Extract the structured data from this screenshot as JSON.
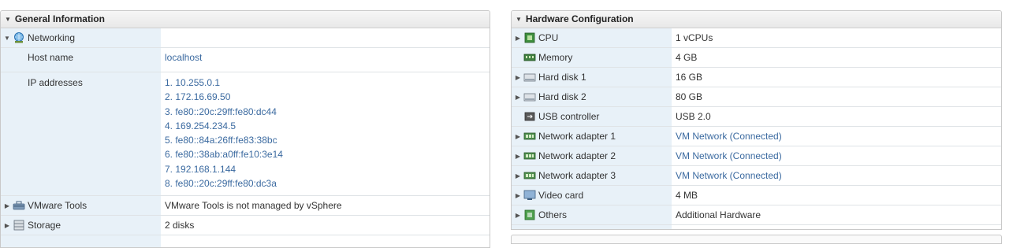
{
  "general": {
    "title": "General Information",
    "networking": {
      "label": "Networking"
    },
    "host_name": {
      "label": "Host name",
      "value": "localhost"
    },
    "ip_addresses": {
      "label": "IP addresses",
      "items": [
        "1. 10.255.0.1",
        "2. 172.16.69.50",
        "3. fe80::20c:29ff:fe80:dc44",
        "4. 169.254.234.5",
        "5. fe80::84a:26ff:fe83:38bc",
        "6. fe80::38ab:a0ff:fe10:3e14",
        "7. 192.168.1.144",
        "8. fe80::20c:29ff:fe80:dc3a"
      ]
    },
    "vmware_tools": {
      "label": "VMware Tools",
      "value": "VMware Tools is not managed by vSphere"
    },
    "storage": {
      "label": "Storage",
      "value": "2 disks"
    }
  },
  "hardware": {
    "title": "Hardware Configuration",
    "rows": [
      {
        "label": "CPU",
        "value": "1 vCPUs",
        "expandable": true,
        "icon": "cpu-icon",
        "link": false
      },
      {
        "label": "Memory",
        "value": "4 GB",
        "expandable": false,
        "icon": "memory-icon",
        "link": false
      },
      {
        "label": "Hard disk 1",
        "value": "16 GB",
        "expandable": true,
        "icon": "hard-disk-icon",
        "link": false
      },
      {
        "label": "Hard disk 2",
        "value": "80 GB",
        "expandable": true,
        "icon": "hard-disk-icon",
        "link": false
      },
      {
        "label": "USB controller",
        "value": "USB 2.0",
        "expandable": false,
        "icon": "usb-controller-icon",
        "link": false
      },
      {
        "label": "Network adapter 1",
        "value": "VM Network (Connected)",
        "expandable": true,
        "icon": "network-adapter-icon",
        "link": true
      },
      {
        "label": "Network adapter 2",
        "value": "VM Network (Connected)",
        "expandable": true,
        "icon": "network-adapter-icon",
        "link": true
      },
      {
        "label": "Network adapter 3",
        "value": "VM Network (Connected)",
        "expandable": true,
        "icon": "network-adapter-icon",
        "link": true
      },
      {
        "label": "Video card",
        "value": "4 MB",
        "expandable": true,
        "icon": "video-card-icon",
        "link": false
      },
      {
        "label": "Others",
        "value": "Additional Hardware",
        "expandable": true,
        "icon": "others-icon",
        "link": false
      }
    ]
  },
  "colors": {
    "link": "#3b6aa0",
    "label_column": "#e8f1f8",
    "border": "#c9c9c9"
  }
}
